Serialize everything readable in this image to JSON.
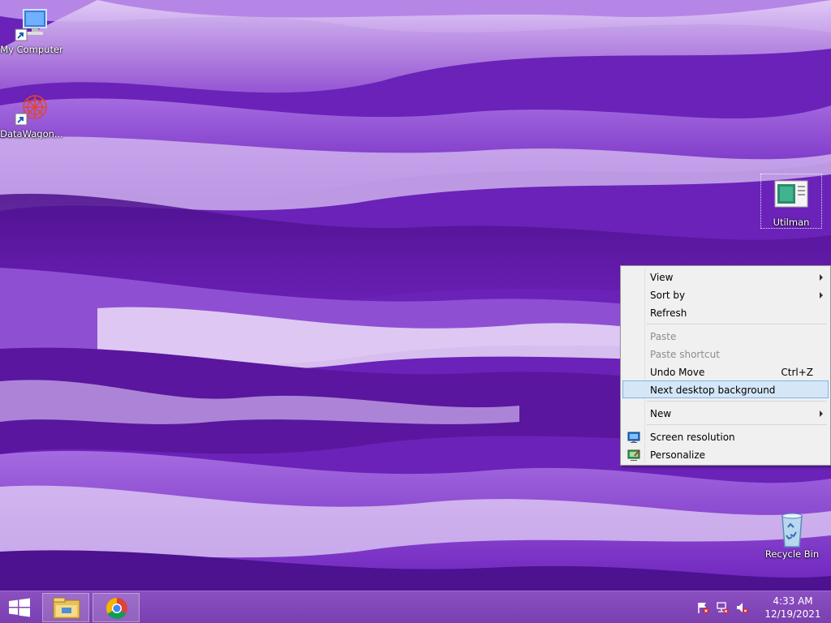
{
  "desktop": {
    "icons": {
      "my_computer": "My Computer",
      "datawagon": "DataWagon...",
      "utilman": "Utilman",
      "recycle_bin": "Recycle Bin"
    }
  },
  "context_menu": {
    "view": "View",
    "sort_by": "Sort by",
    "refresh": "Refresh",
    "paste": "Paste",
    "paste_shortcut": "Paste shortcut",
    "undo_move": "Undo Move",
    "undo_move_shortcut": "Ctrl+Z",
    "next_background": "Next desktop background",
    "new": "New",
    "screen_resolution": "Screen resolution",
    "personalize": "Personalize"
  },
  "taskbar": {
    "apps": [
      "file-explorer-icon",
      "chrome-icon"
    ],
    "clock": {
      "time": "4:33 AM",
      "date": "12/19/2021"
    }
  },
  "colors": {
    "menu_highlight": "#d5e6f7",
    "menu_highlight_border": "#7eb4ea",
    "taskbar": "#7a3fb0"
  }
}
